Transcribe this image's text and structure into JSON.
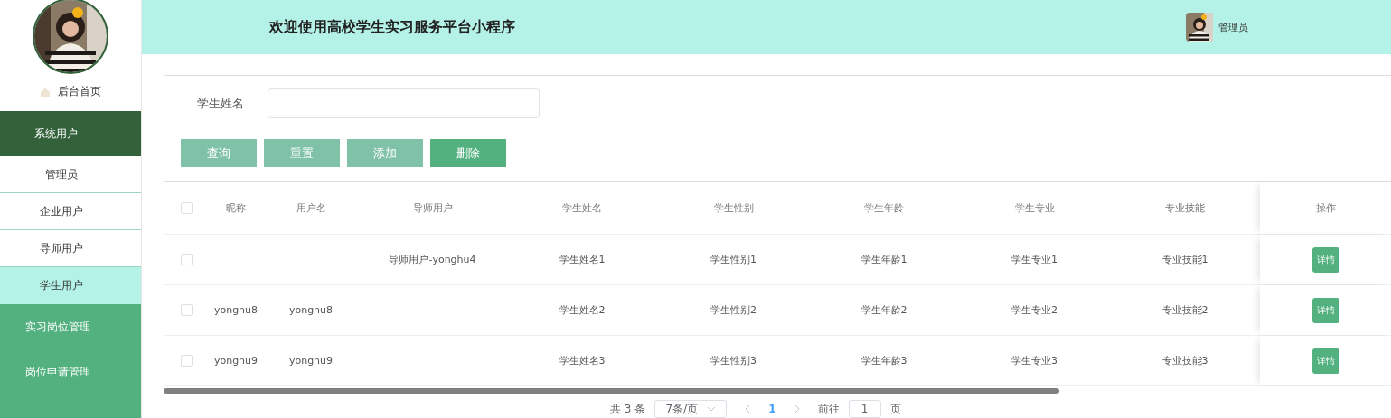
{
  "sidebar": {
    "home": "后台首页",
    "menu": [
      {
        "label": "系统用户",
        "expanded": true,
        "children": [
          {
            "label": "管理员",
            "selected": false
          },
          {
            "label": "企业用户",
            "selected": false
          },
          {
            "label": "导师用户",
            "selected": false
          },
          {
            "label": "学生用户",
            "selected": true
          }
        ]
      },
      {
        "label": "实习岗位管理",
        "expanded": false
      },
      {
        "label": "岗位申请管理",
        "expanded": false
      }
    ]
  },
  "header": {
    "title": "欢迎使用高校学生实习服务平台小程序",
    "user": "管理员"
  },
  "search": {
    "label": "学生姓名"
  },
  "buttons": [
    {
      "label": "查询",
      "kind": "light"
    },
    {
      "label": "重置",
      "kind": "light"
    },
    {
      "label": "添加",
      "kind": "light"
    },
    {
      "label": "删除",
      "kind": "primary"
    }
  ],
  "table": {
    "all_checked": false,
    "columns": [
      "昵称",
      "用户名",
      "导师用户",
      "学生姓名",
      "学生性别",
      "学生年龄",
      "学生专业",
      "专业技能",
      "操作"
    ],
    "rows": [
      {
        "checked": false,
        "cells": [
          null,
          null,
          "导师用户-yonghu4",
          "学生姓名1",
          "学生性别1",
          "学生年龄1",
          "学生专业1",
          "专业技能1"
        ],
        "action": "详情"
      },
      {
        "checked": false,
        "cells": [
          "yonghu8",
          "yonghu8",
          null,
          "学生姓名2",
          "学生性别2",
          "学生年龄2",
          "学生专业2",
          "专业技能2"
        ],
        "action": "详情"
      },
      {
        "checked": false,
        "cells": [
          "yonghu9",
          "yonghu9",
          null,
          "学生姓名3",
          "学生性别3",
          "学生年龄3",
          "学生专业3",
          "专业技能3"
        ],
        "action": "详情"
      }
    ]
  },
  "pagination": {
    "total": "共 3 条",
    "page_size": "7条/页",
    "pages": [
      {
        "label": "1",
        "selected": true
      }
    ],
    "goto_label": "前往",
    "goto_value": "1",
    "goto_suffix": "页"
  }
}
